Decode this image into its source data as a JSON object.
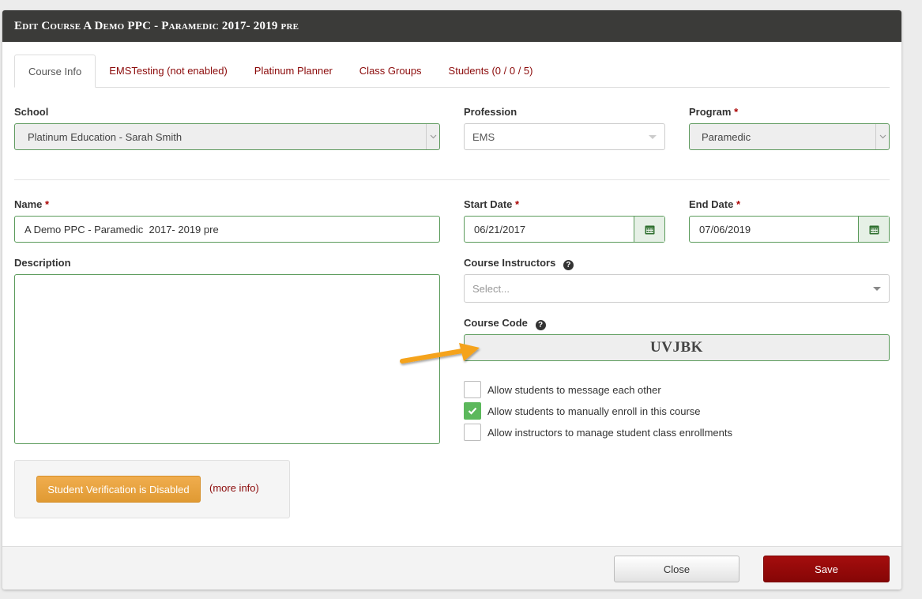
{
  "modal": {
    "title": "Edit Course A Demo PPC - Paramedic 2017- 2019 pre"
  },
  "tabs": [
    {
      "label": "Course Info"
    },
    {
      "label": "EMSTesting (not enabled)"
    },
    {
      "label": "Platinum Planner"
    },
    {
      "label": "Class Groups"
    },
    {
      "label": "Students (0 / 0 / 5)"
    }
  ],
  "school": {
    "label": "School",
    "value": "Platinum Education - Sarah Smith"
  },
  "profession": {
    "label": "Profession",
    "value": "EMS"
  },
  "program": {
    "label": "Program",
    "required_mark": "*",
    "value": "Paramedic"
  },
  "name": {
    "label": "Name",
    "required_mark": "*",
    "value": "A Demo PPC - Paramedic  2017- 2019 pre"
  },
  "start_date": {
    "label": "Start Date",
    "required_mark": "*",
    "value": "06/21/2017"
  },
  "end_date": {
    "label": "End Date",
    "required_mark": "*",
    "value": "07/06/2019"
  },
  "description": {
    "label": "Description",
    "value": ""
  },
  "instructors": {
    "label": "Course Instructors",
    "placeholder": "Select...",
    "help_glyph": "?"
  },
  "course_code": {
    "label": "Course Code",
    "value": "UVJBK",
    "help_glyph": "?"
  },
  "options": [
    {
      "label": "Allow students to message each other",
      "checked": false
    },
    {
      "label": "Allow students to manually enroll in this course",
      "checked": true
    },
    {
      "label": "Allow instructors to manage student class enrollments",
      "checked": false
    }
  ],
  "verification": {
    "button_label": "Student Verification is Disabled",
    "more_info": "(more info)"
  },
  "footer": {
    "close_label": "Close",
    "save_label": "Save"
  },
  "colors": {
    "header_bg": "#3b3b39",
    "link": "#8b0a0a",
    "field_border": "#5a9a5a",
    "check_green": "#5cb85c",
    "warning_orange": "#f0ad4e",
    "save_red": "#a40d0d",
    "arrow": "#f5a31a"
  },
  "icons": {
    "calendar": "calendar-icon",
    "help": "question-circle-icon",
    "check": "checkmark-icon",
    "annotation": "arrow-annotation"
  }
}
